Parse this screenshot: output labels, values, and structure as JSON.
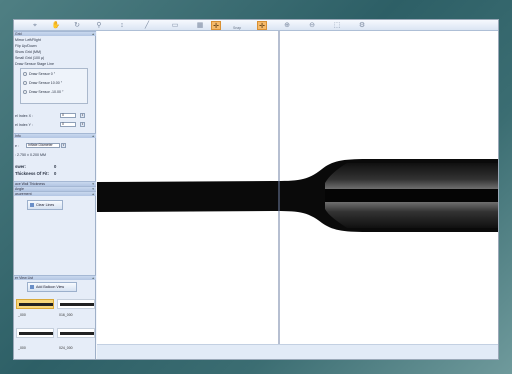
{
  "toolbar": {
    "snap_label": "Snap",
    "tools": [
      "cursor-tool",
      "pan-tool",
      "rotate-tool",
      "magnify-tool",
      "measure-tool",
      "line-tool",
      "ruler-tool",
      "grid-tool",
      "snap-tool",
      "point-tool",
      "zoom-in-tool",
      "zoom-out-tool",
      "fit-tool",
      "settings-tool"
    ]
  },
  "panel": {
    "grid_section": "Grid",
    "items": [
      "Mirror Left/Right",
      "Flip Up/Down",
      "Show Grid (MM)",
      "Small Grid (100 µ)",
      "Draw Sensor Stage Line"
    ],
    "sensors": [
      "Draw Sensor 0 °",
      "Draw Sensor 10.00 °",
      "Draw Sensor -10.00 °"
    ],
    "offset_x_label": "el Index X :",
    "offset_x_value": "0",
    "offset_y_label": "el Index Y :",
    "offset_y_value": "0",
    "info_section": "Info",
    "mode_label": "e :",
    "mode_value": "Inflate Diameter",
    "diameter_readout": ": 2.750 ± 0.200 MM",
    "answer_label": "swer:",
    "answer_value": "0",
    "fit_label": "Thickness Of Fit:",
    "fit_value": "0",
    "thickness_section": "ace Wall Thickness",
    "angle_section": "Angle",
    "measure_section": "asurement",
    "clear_lines": "Clear Lines",
    "view_list_section": "er View List",
    "add_balloon": "Add Balloon View",
    "thumbs": [
      {
        "label": "_000",
        "selected": true
      },
      {
        "label": "016_000",
        "selected": false
      },
      {
        "label": "_000",
        "selected": false
      },
      {
        "label": "024_000",
        "selected": false
      }
    ]
  },
  "view": {
    "marker_x_fraction": 0.451,
    "background": "#ffffff",
    "tube_color": "#0a0a0a"
  },
  "colors": {
    "accent": "#f5b969",
    "panel": "#e6edf8",
    "header": "#b3c6e3"
  }
}
